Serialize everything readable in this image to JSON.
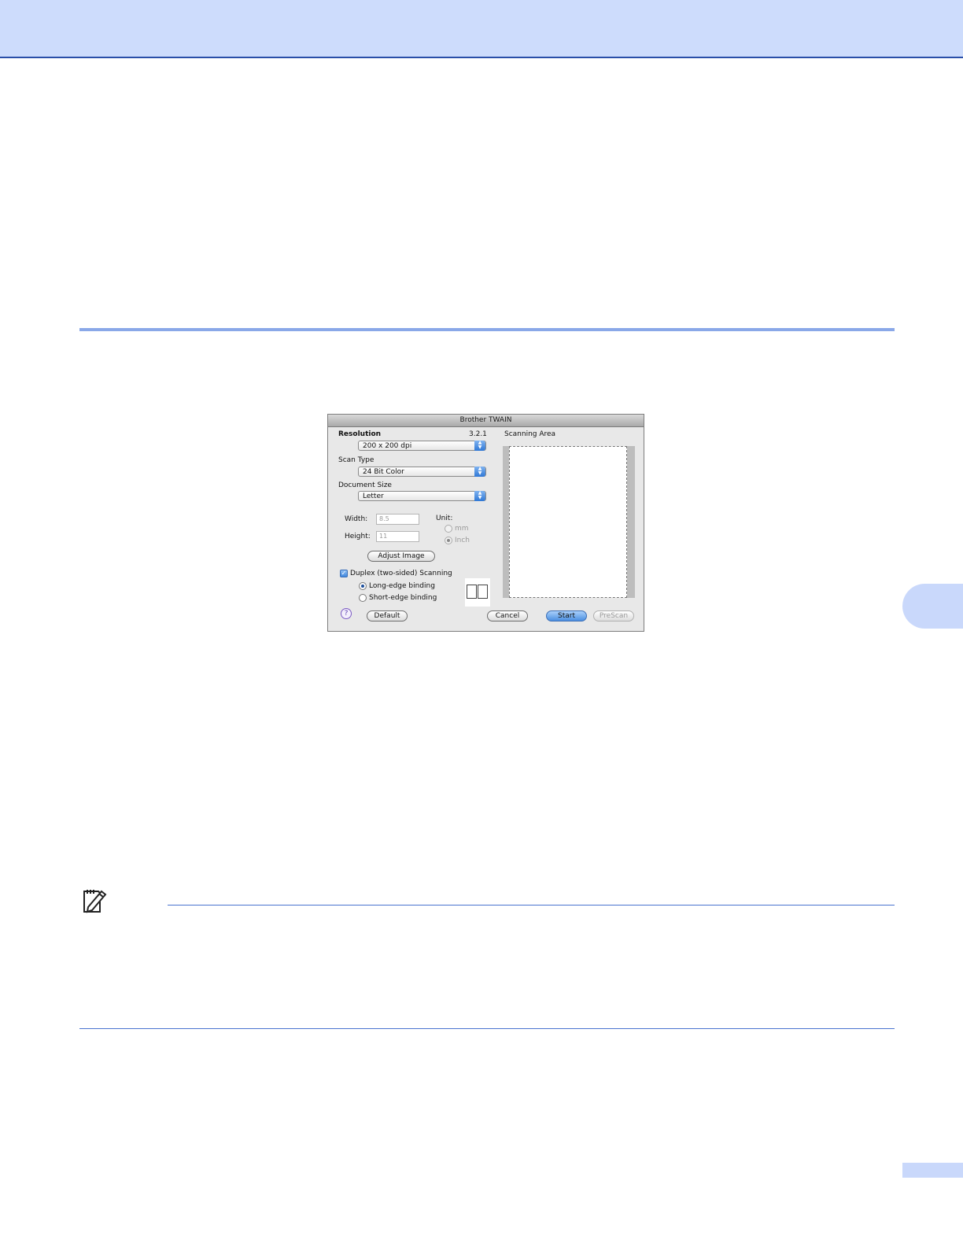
{
  "dialog": {
    "title": "Brother TWAIN",
    "version": "3.2.1",
    "resolution": {
      "label": "Resolution",
      "value": "200 x 200 dpi"
    },
    "scan_type": {
      "label": "Scan Type",
      "value": "24 Bit Color"
    },
    "document_size": {
      "label": "Document Size",
      "value": "Letter"
    },
    "width": {
      "label": "Width:",
      "value": "8.5"
    },
    "height": {
      "label": "Height:",
      "value": "11"
    },
    "unit": {
      "label": "Unit:",
      "options": [
        "mm",
        "Inch"
      ],
      "selected": "Inch"
    },
    "adjust_image_label": "Adjust Image",
    "duplex": {
      "label": "Duplex (two-sided) Scanning",
      "checked": true,
      "options": [
        "Long-edge binding",
        "Short-edge binding"
      ],
      "selected": "Long-edge binding"
    },
    "scanning_area_label": "Scanning Area",
    "help_glyph": "?",
    "buttons": {
      "default": "Default",
      "cancel": "Cancel",
      "start": "Start",
      "prescan": "PreScan"
    }
  },
  "icons": [
    "note-pencil-icon",
    "help-icon",
    "popup-arrow-icon",
    "checkbox-check-icon"
  ],
  "colors": {
    "header": "#cddcfc",
    "accent_rule": "#8aa8e8",
    "note_rule": "#4a74d0",
    "tab": "#c9d8fb"
  }
}
